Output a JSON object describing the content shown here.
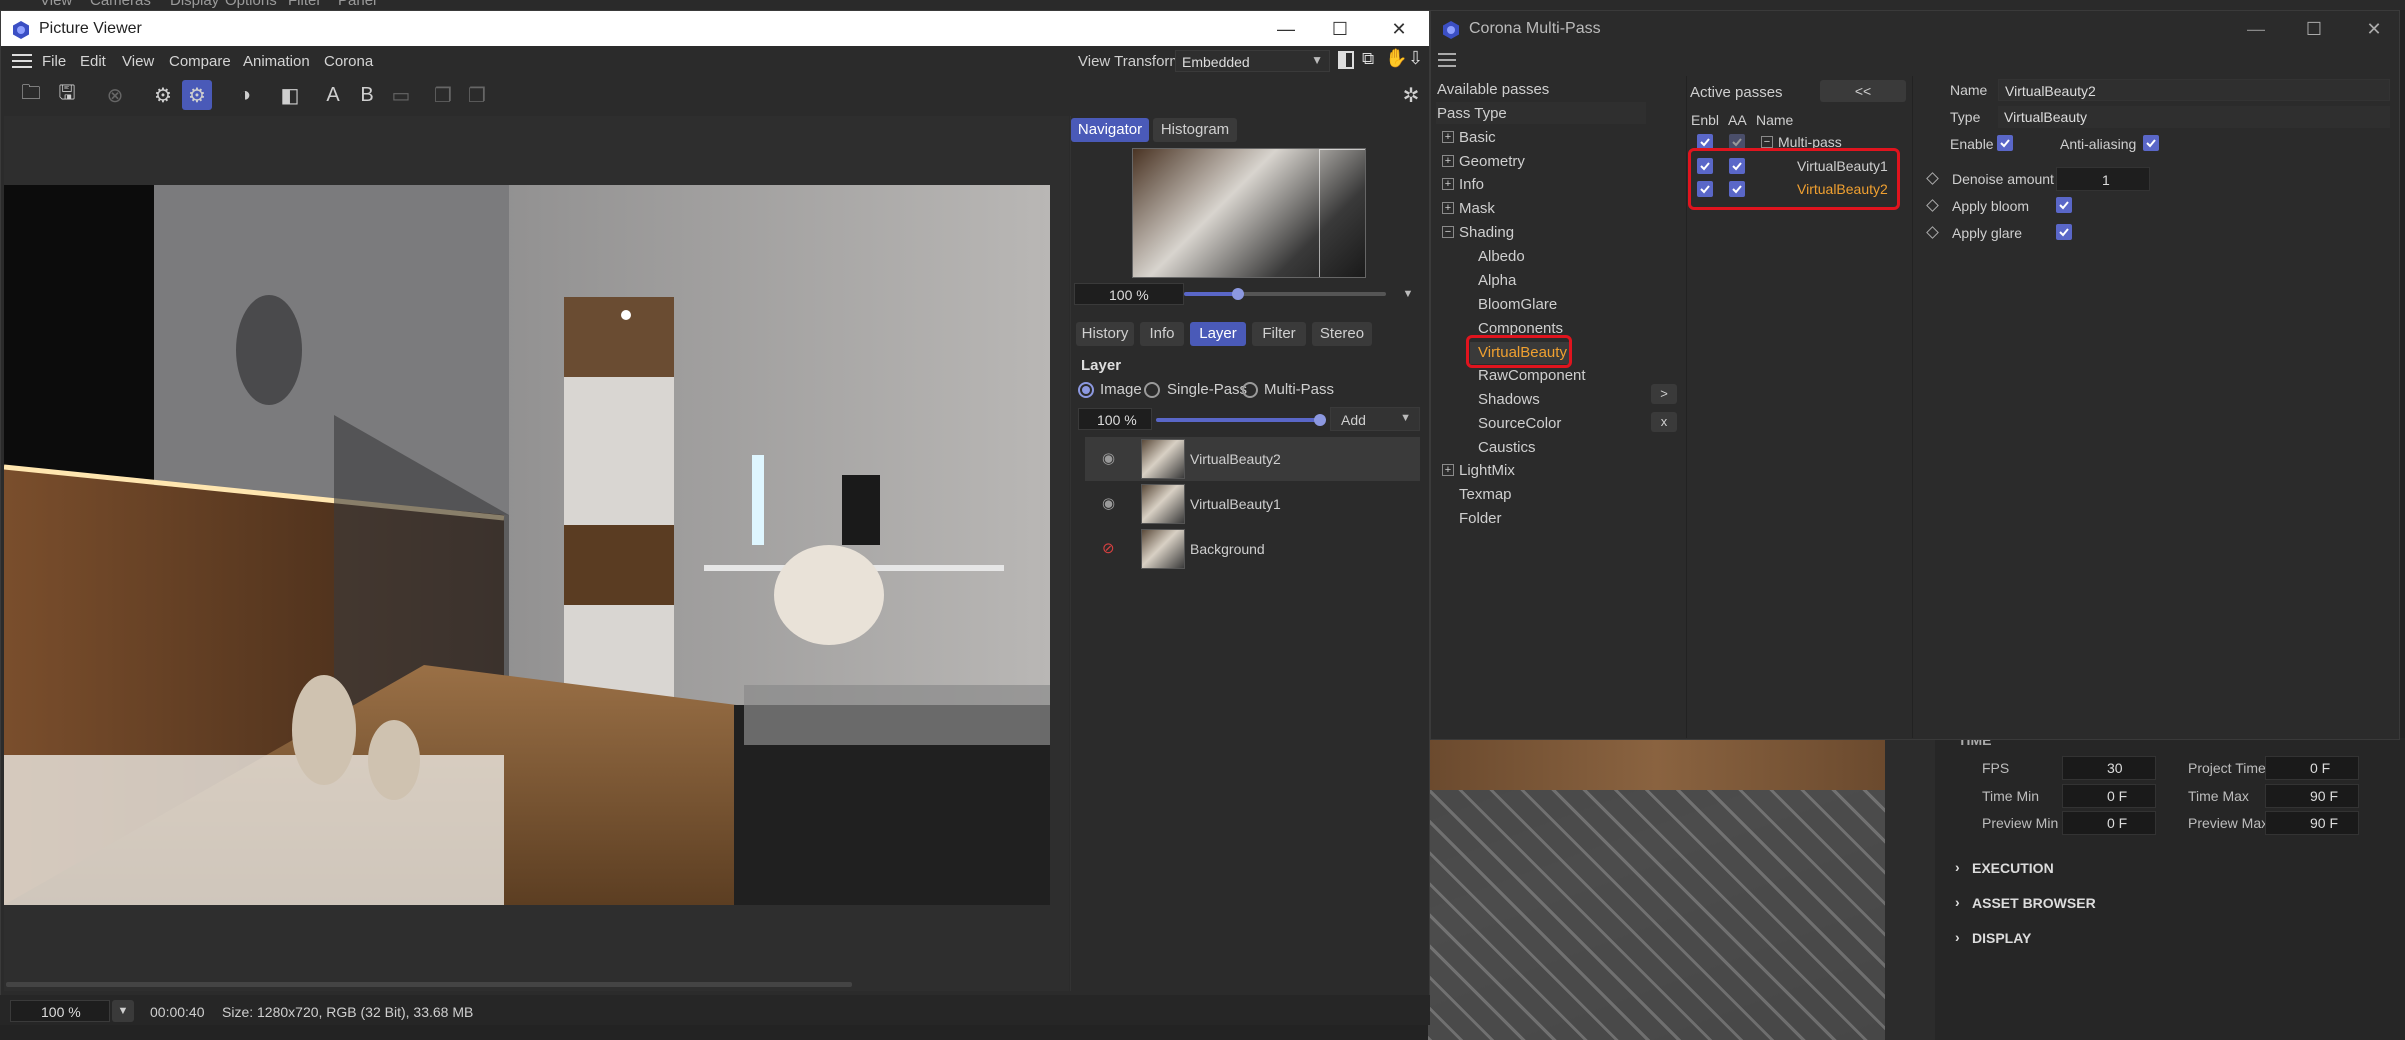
{
  "background_app": {
    "menu": [
      "View",
      "Cameras",
      "Display",
      "Options",
      "Filter",
      "Panel"
    ],
    "time": {
      "section": "TIME",
      "fps_label": "FPS",
      "fps_value": "30",
      "project_time_label": "Project Time",
      "project_time_value": "0 F",
      "time_min_label": "Time Min",
      "time_min_value": "0 F",
      "time_max_label": "Time Max",
      "time_max_value": "90 F",
      "preview_min_label": "Preview Min",
      "preview_min_value": "0 F",
      "preview_max_label": "Preview Max",
      "preview_max_value": "90 F"
    },
    "sections": [
      "EXECUTION",
      "ASSET BROWSER",
      "DISPLAY"
    ]
  },
  "picture_viewer": {
    "title": "Picture Viewer",
    "window_controls": {
      "minimize": "—",
      "maximize": "☐",
      "close": "✕"
    },
    "menu": [
      "File",
      "Edit",
      "View",
      "Compare",
      "Animation",
      "Corona"
    ],
    "view_transform_label": "View Transform",
    "view_transform_value": "Embedded",
    "toolbar_letters": {
      "a": "A",
      "b": "B"
    },
    "navigator_tabs": [
      "Navigator",
      "Histogram"
    ],
    "navigator_zoom": "100 %",
    "panel_tabs": [
      "History",
      "Info",
      "Layer",
      "Filter",
      "Stereo"
    ],
    "layer": {
      "heading": "Layer",
      "modes": [
        "Image",
        "Single-Pass",
        "Multi-Pass"
      ],
      "opacity": "100 %",
      "add_label": "Add",
      "rows": [
        "VirtualBeauty2",
        "VirtualBeauty1",
        "Background"
      ]
    },
    "status": {
      "zoom": "100 %",
      "time": "00:00:40",
      "info": "Size: 1280x720, RGB (32 Bit), 33.68 MB"
    }
  },
  "multipass": {
    "title": "Corona Multi-Pass",
    "available_label": "Available passes",
    "pass_type_label": "Pass Type",
    "categories": [
      "Basic",
      "Geometry",
      "Info",
      "Mask",
      "Shading",
      "LightMix",
      "Texmap",
      "Folder"
    ],
    "shading_children": [
      "Albedo",
      "Alpha",
      "BloomGlare",
      "Components",
      "VirtualBeauty",
      "RawComponent",
      "Shadows",
      "SourceColor",
      "Caustics"
    ],
    "move_right": ">",
    "remove": "x",
    "active_label": "Active passes",
    "collapse_button": "<<",
    "columns": {
      "enbl": "Enbl",
      "aa": "AA",
      "name": "Name"
    },
    "root": "Multi-pass",
    "active_items": [
      "VirtualBeauty1",
      "VirtualBeauty2"
    ],
    "props": {
      "name_label": "Name",
      "name_value": "VirtualBeauty2",
      "type_label": "Type",
      "type_value": "VirtualBeauty",
      "enable_label": "Enable",
      "aa_label": "Anti-aliasing",
      "denoise_label": "Denoise amount",
      "denoise_value": "1",
      "bloom_label": "Apply bloom",
      "glare_label": "Apply glare"
    }
  },
  "colors": {
    "accent": "#4a5ab8",
    "highlight": "#e0141e",
    "selected_text": "#f0a030"
  }
}
